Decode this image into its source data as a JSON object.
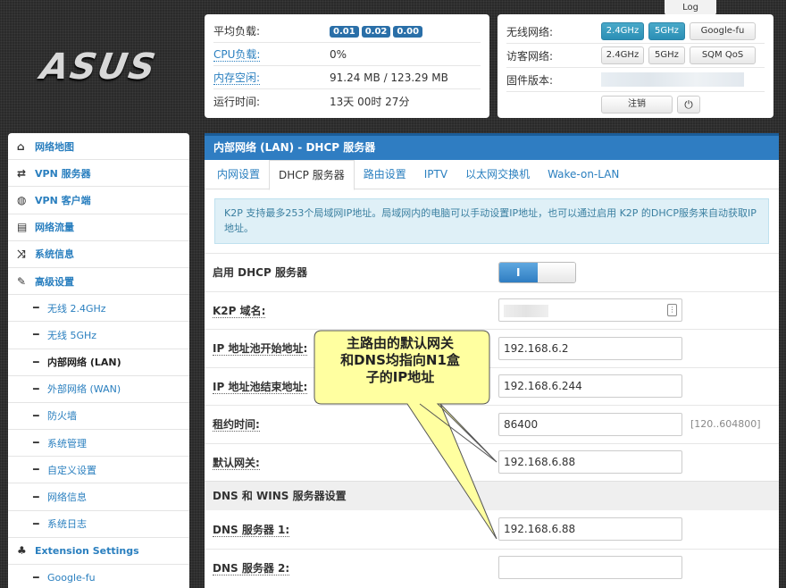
{
  "logo": "ASUS",
  "top_tab": "Log",
  "status": {
    "rows": [
      {
        "label": "平均负载:",
        "loads": [
          "0.01",
          "0.02",
          "0.00"
        ]
      },
      {
        "label": "CPU负载:",
        "value": "0%"
      },
      {
        "label": "内存空闲:",
        "value": "91.24 MB / 123.29 MB"
      },
      {
        "label": "运行时间:",
        "value": "13天 00时 27分"
      }
    ]
  },
  "wireless": {
    "wifi_label": "无线网络:",
    "wifi_buttons": [
      "2.4GHz",
      "5GHz",
      "Google-fu"
    ],
    "guest_label": "访客网络:",
    "guest_buttons": [
      "2.4GHz",
      "5GHz",
      "SQM QoS"
    ],
    "firmware_label": "固件版本:",
    "logout": "注销",
    "power_icon": "⏻"
  },
  "sidebar": {
    "items": [
      {
        "label": "网络地图",
        "icon": "home-icon",
        "glyph": "⌂"
      },
      {
        "label": "VPN 服务器",
        "icon": "retweet-icon",
        "glyph": "⇄"
      },
      {
        "label": "VPN 客户端",
        "icon": "globe-icon",
        "glyph": "◍"
      },
      {
        "label": "网络流量",
        "icon": "hdd-icon",
        "glyph": "▤"
      },
      {
        "label": "系统信息",
        "icon": "random-icon",
        "glyph": "⤨"
      },
      {
        "label": "高级设置",
        "icon": "wrench-icon",
        "glyph": "✎"
      }
    ],
    "subs": [
      "无线 2.4GHz",
      "无线 5GHz",
      "内部网络 (LAN)",
      "外部网络 (WAN)",
      "防火墙",
      "系统管理",
      "自定义设置",
      "网络信息",
      "系统日志"
    ],
    "ext_label": "Extension Settings",
    "ext_glyph": "♣",
    "ext_sub": "Google-fu"
  },
  "main": {
    "title": "内部网络 (LAN) - DHCP 服务器",
    "tabs": [
      "内网设置",
      "DHCP 服务器",
      "路由设置",
      "IPTV",
      "以太网交换机",
      "Wake-on-LAN"
    ],
    "info": "K2P 支持最多253个局域网IP地址。局域网内的电脑可以手动设置IP地址，也可以通过启用 K2P 的DHCP服务来自动获取IP地址。",
    "enable_dhcp": "启用 DHCP 服务器",
    "toggle_on": "I",
    "domain_label": "K2P 域名:",
    "pool_start_label": "IP 地址池开始地址:",
    "pool_start": "192.168.6.2",
    "pool_end_label": "IP 地址池结束地址:",
    "pool_end": "192.168.6.244",
    "lease_label": "租约时间:",
    "lease": "86400",
    "lease_range": "[120..604800]",
    "gateway_label": "默认网关:",
    "gateway": "192.168.6.88",
    "dns_section": "DNS 和 WINS 服务器设置",
    "dns1_label": "DNS 服务器 1:",
    "dns1": "192.168.6.88",
    "dns2_label": "DNS 服务器 2:",
    "dns2": ""
  },
  "callout": [
    "主路由的默认网关",
    "和DNS均指向N1盒",
    "子的IP地址"
  ]
}
